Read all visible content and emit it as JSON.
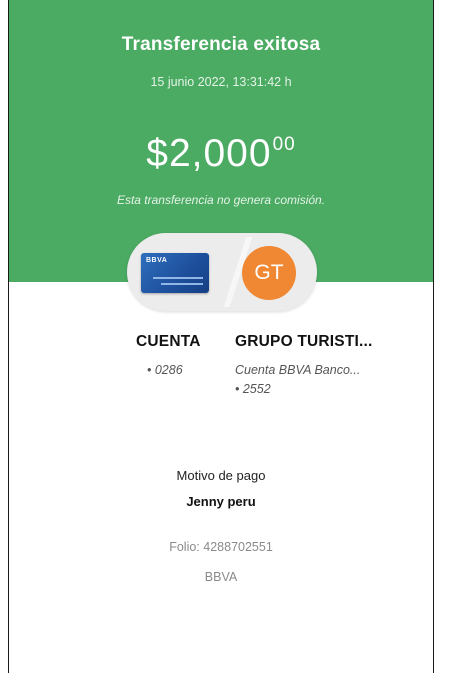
{
  "header": {
    "title": "Transferencia exitosa",
    "datetime": "15 junio 2022, 13:31:42 h"
  },
  "amount": {
    "whole": "$2,000",
    "cents": "00"
  },
  "fee_note": "Esta transferencia no genera comisión.",
  "origin": {
    "card_logo": "BBVA",
    "name": "CUENTA",
    "number": "• 0286"
  },
  "destination": {
    "initials": "GT",
    "name": "GRUPO TURISTI...",
    "bank": "Cuenta BBVA Banco...",
    "number": "• 2552"
  },
  "details": {
    "motivo_label": "Motivo de pago",
    "motivo_value": "Jenny peru",
    "folio": "Folio: 4288702551",
    "bank": "BBVA"
  },
  "colors": {
    "header_green": "#4bab63",
    "avatar_orange": "#f08733",
    "card_blue": "#1d4f9c"
  }
}
